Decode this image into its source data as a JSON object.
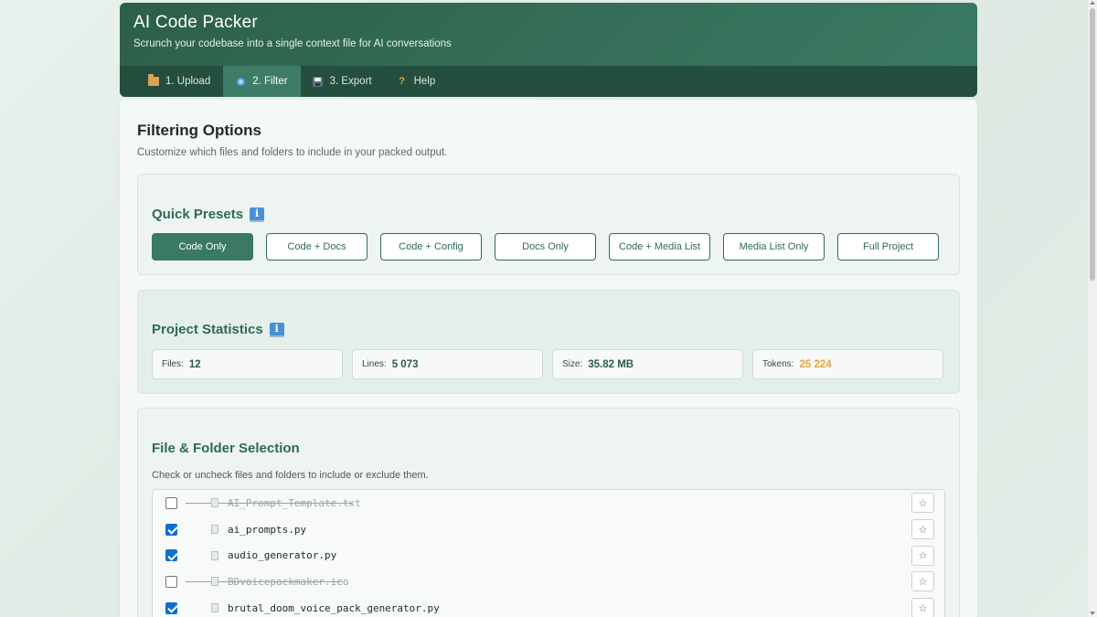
{
  "header": {
    "title": "AI Code Packer",
    "subtitle": "Scrunch your codebase into a single context file for AI conversations"
  },
  "tabs": [
    {
      "label": "1. Upload",
      "icon": "folder-icon",
      "active": false
    },
    {
      "label": "2. Filter",
      "icon": "magnifier-icon",
      "active": true
    },
    {
      "label": "3. Export",
      "icon": "floppy-disk-icon",
      "active": false
    },
    {
      "label": "Help",
      "icon": "question-icon",
      "active": false
    }
  ],
  "main": {
    "title": "Filtering Options",
    "description": "Customize which files and folders to include in your packed output."
  },
  "presets": {
    "title": "Quick Presets",
    "buttons": [
      {
        "label": "Code Only",
        "active": true
      },
      {
        "label": "Code + Docs",
        "active": false
      },
      {
        "label": "Code + Config",
        "active": false
      },
      {
        "label": "Docs Only",
        "active": false
      },
      {
        "label": "Code + Media List",
        "active": false
      },
      {
        "label": "Media List Only",
        "active": false
      },
      {
        "label": "Full Project",
        "active": false
      }
    ]
  },
  "stats": {
    "title": "Project Statistics",
    "items": [
      {
        "label": "Files:",
        "value": "12"
      },
      {
        "label": "Lines:",
        "value": "5 073"
      },
      {
        "label": "Size:",
        "value": "35.82 MB"
      },
      {
        "label": "Tokens:",
        "value": "25 224"
      }
    ],
    "tokens_color": "#e8a43c"
  },
  "files": {
    "title": "File & Folder Selection",
    "description": "Check or uncheck files and folders to include or exclude them.",
    "list": [
      {
        "name": "AI_Prompt_Template.txt",
        "checked": false,
        "star": "☆"
      },
      {
        "name": "ai_prompts.py",
        "checked": true,
        "star": "☆"
      },
      {
        "name": "audio_generator.py",
        "checked": true,
        "star": "☆"
      },
      {
        "name": "BDvoicepackmaker.ico",
        "checked": false,
        "star": "☆"
      },
      {
        "name": "brutal_doom_voice_pack_generator.py",
        "checked": true,
        "star": "☆"
      }
    ]
  },
  "colors": {
    "header": "#2c5f4a",
    "accent": "#3a7a62",
    "checkbox": "#0f6fd1"
  }
}
